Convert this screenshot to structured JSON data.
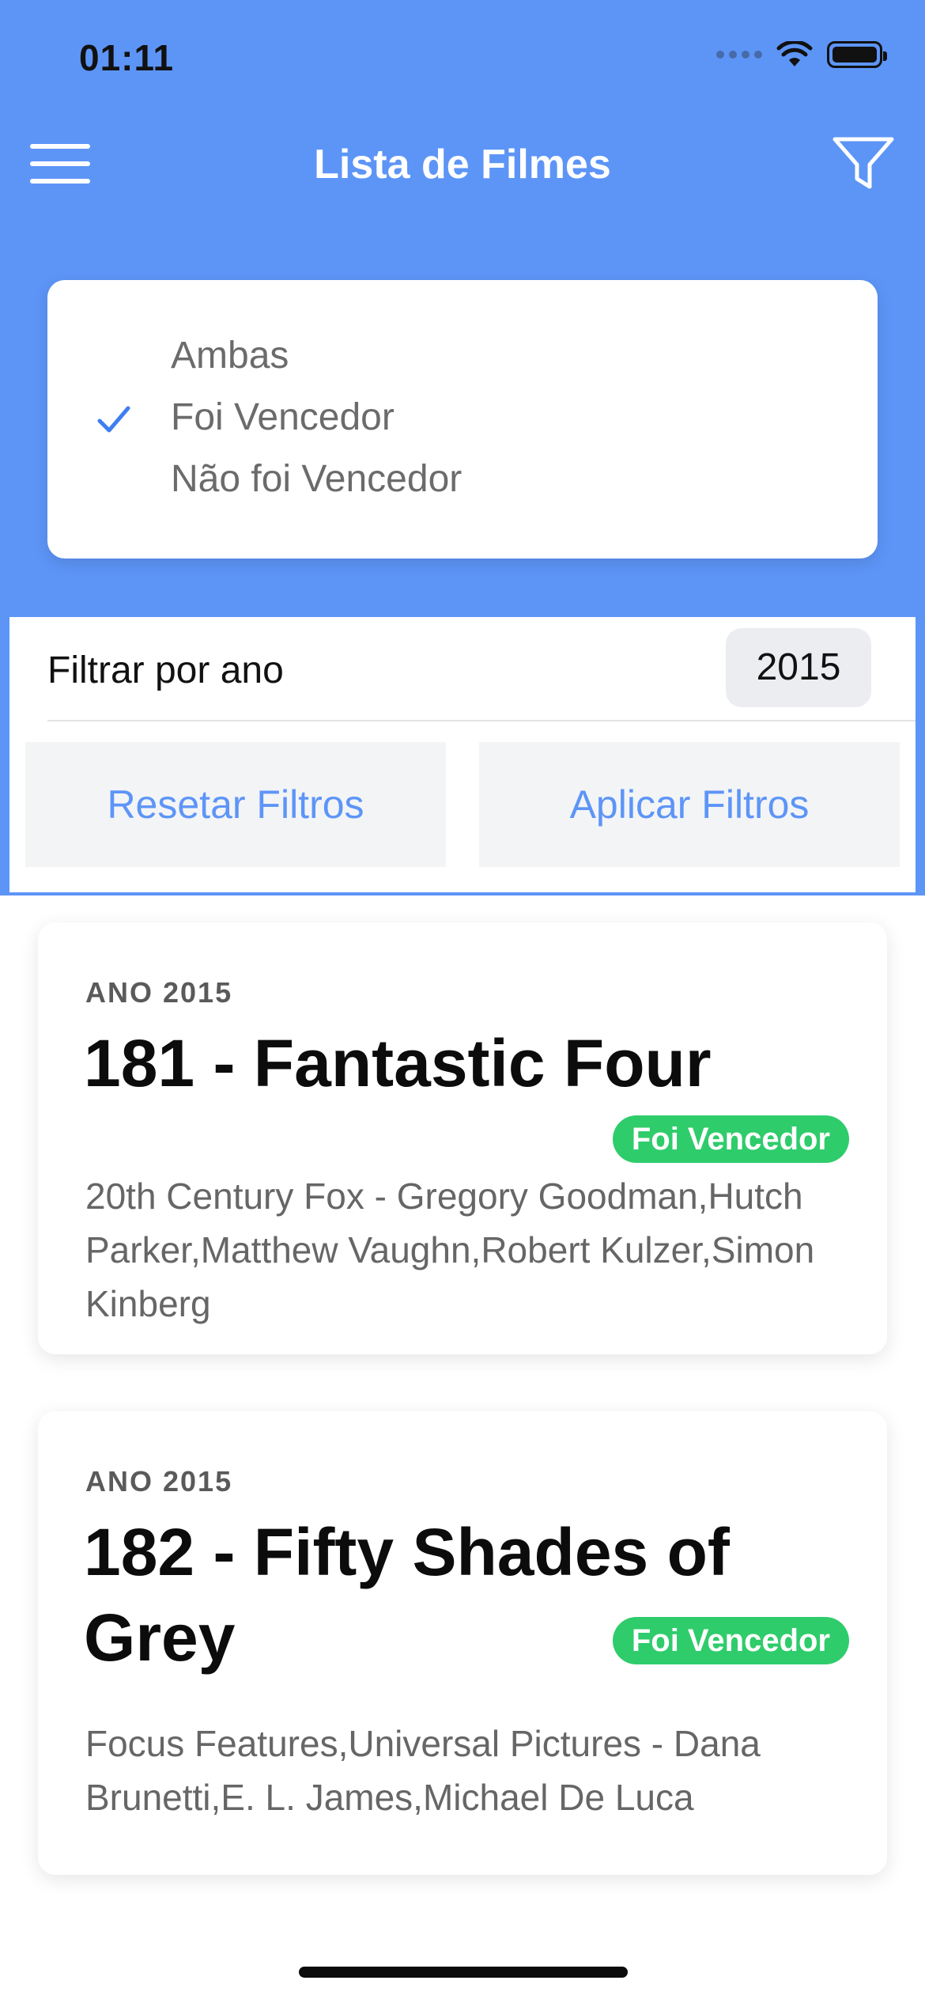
{
  "status_bar": {
    "time": "01:11"
  },
  "nav": {
    "title": "Lista de Filmes",
    "menu_icon": "hamburger-menu-icon",
    "filter_icon": "funnel-filter-icon"
  },
  "winner_filter": {
    "options": [
      "Ambas",
      "Foi Vencedor",
      "Não foi Vencedor"
    ],
    "selected": "Foi Vencedor"
  },
  "year_filter": {
    "label": "Filtrar por ano",
    "value": "2015"
  },
  "actions": {
    "reset_label": "Resetar Filtros",
    "apply_label": "Aplicar Filtros"
  },
  "movies": [
    {
      "year_label": "ANO 2015",
      "title": "181 - Fantastic Four",
      "badge": "Foi Vencedor",
      "description": "20th Century Fox - Gregory Goodman,Hutch Parker,Matthew Vaughn,Robert Kulzer,Simon Kinberg"
    },
    {
      "year_label": "ANO 2015",
      "title": "182 - Fifty Shades of Grey",
      "badge": "Foi Vencedor",
      "description": "Focus Features,Universal Pictures - Dana Brunetti,E. L. James,Michael De Luca"
    }
  ],
  "colors": {
    "header_blue": "#5d95f7",
    "badge_green": "#2fcc6b",
    "button_text": "#5d95f7"
  }
}
